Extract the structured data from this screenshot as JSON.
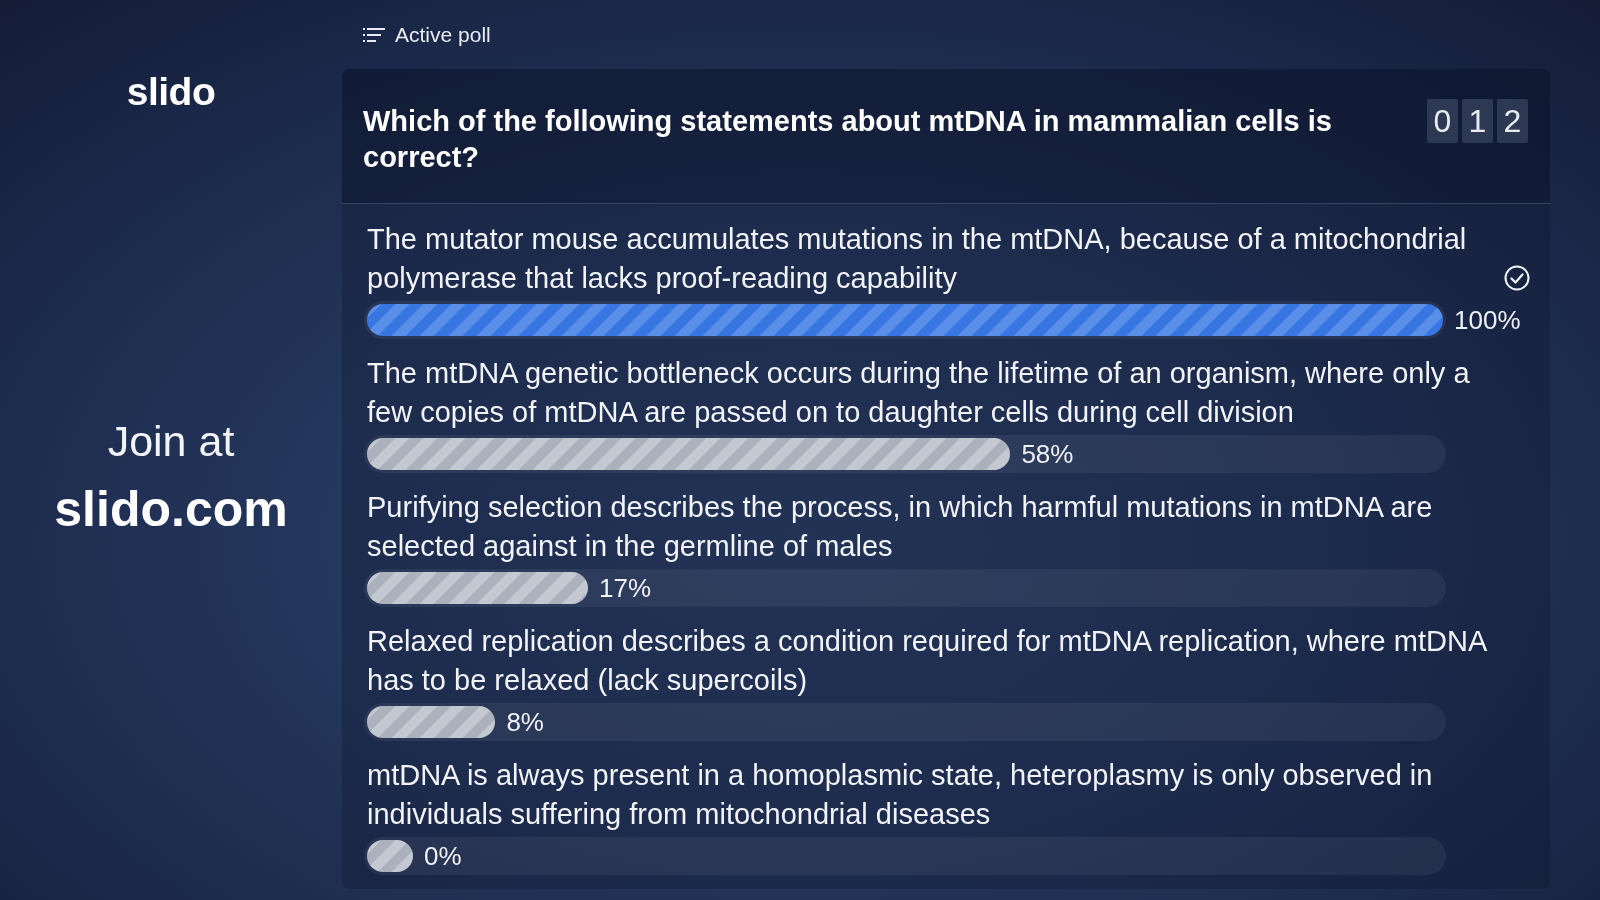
{
  "sidebar": {
    "logo": "slido",
    "join_prompt": "Join at",
    "join_url": "slido.com"
  },
  "header": {
    "label": "Active poll"
  },
  "poll": {
    "question": "Which of the following statements about mtDNA in mammalian cells is correct?",
    "vote_counter": [
      "0",
      "1",
      "2"
    ],
    "options": [
      {
        "text": "The mutator mouse accumulates mutations in the mtDNA, because of a mitochondrial polymerase that lacks proof-reading capability",
        "correct": true,
        "level": 1,
        "percent": "100%"
      },
      {
        "text": "The mtDNA genetic bottleneck occurs during the lifetime of an organism, where only a few copies of mtDNA are passed on to daughter cells during cell division",
        "correct": false,
        "level": 0.58,
        "percent": "58%"
      },
      {
        "text": "Purifying selection describes the process, in which harmful mutations in mtDNA are selected against in the germline of males",
        "correct": false,
        "level": 0.17,
        "percent": "17%"
      },
      {
        "text": "Relaxed replication describes a condition required for mtDNA replication, where mtDNA has to be relaxed (lack supercoils)",
        "correct": false,
        "level": 0.08,
        "percent": "8%"
      },
      {
        "text": "mtDNA is always present in a homoplasmic state, heteroplasmy is only observed in individuals suffering from mitochondrial diseases",
        "correct": false,
        "level": 0,
        "percent": "0%"
      }
    ]
  }
}
